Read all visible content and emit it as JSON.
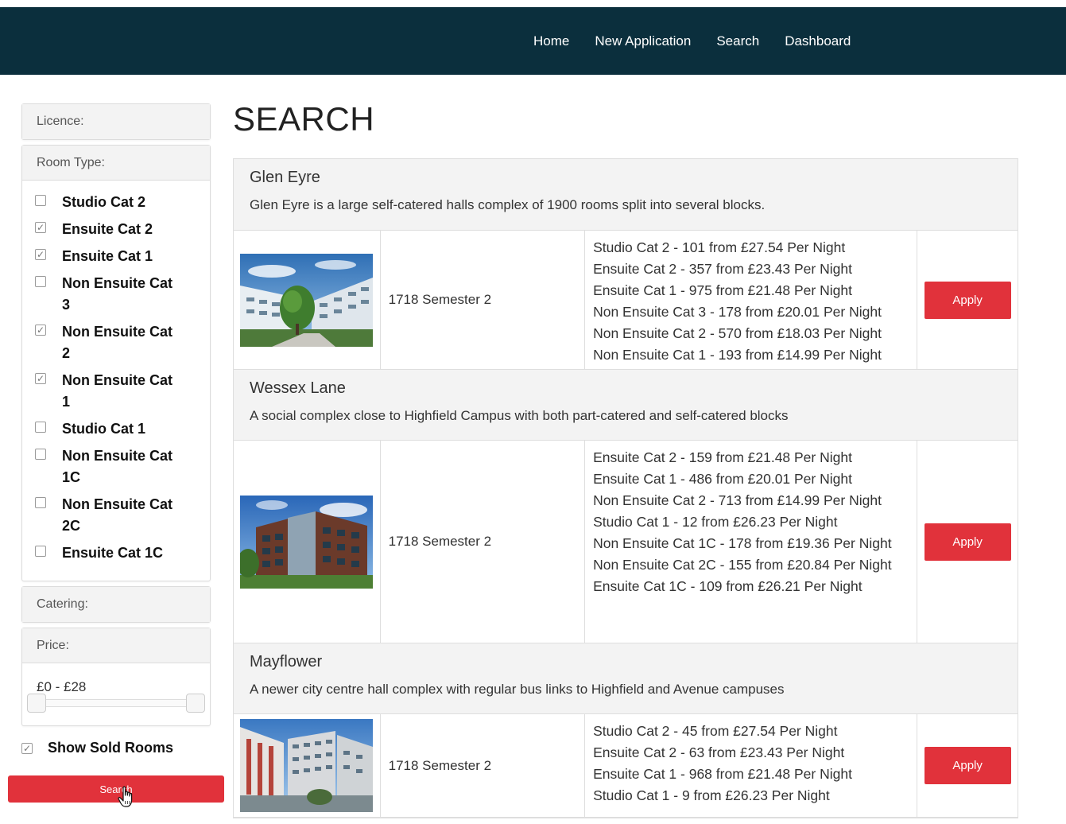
{
  "nav": {
    "items": [
      "Home",
      "New Application",
      "Search",
      "Dashboard"
    ]
  },
  "sidebar": {
    "licence_label": "Licence:",
    "room_type_label": "Room Type:",
    "room_types": [
      {
        "label": "Studio Cat 2",
        "checked": false
      },
      {
        "label": "Ensuite Cat 2",
        "checked": true
      },
      {
        "label": "Ensuite Cat 1",
        "checked": true
      },
      {
        "label": "Non Ensuite Cat 3",
        "checked": false
      },
      {
        "label": "Non Ensuite Cat 2",
        "checked": true
      },
      {
        "label": "Non Ensuite Cat 1",
        "checked": true
      },
      {
        "label": "Studio Cat 1",
        "checked": false
      },
      {
        "label": "Non Ensuite Cat 1C",
        "checked": false
      },
      {
        "label": "Non Ensuite Cat 2C",
        "checked": false
      },
      {
        "label": "Ensuite Cat 1C",
        "checked": false
      }
    ],
    "catering_label": "Catering:",
    "price_label": "Price:",
    "price_range": "£0 - £28",
    "show_sold_label": "Show Sold Rooms",
    "show_sold_checked": true,
    "search_button": "Search"
  },
  "main": {
    "title": "SEARCH",
    "halls": [
      {
        "name": "Glen Eyre",
        "description": "Glen Eyre is a large self-catered halls complex of 1900 rooms split into several blocks.",
        "semester": "1718 Semester 2",
        "rooms": [
          "Studio Cat 2 - 101 from £27.54 Per Night",
          "Ensuite Cat 2 - 357 from £23.43 Per Night",
          "Ensuite Cat 1 - 975 from £21.48 Per Night",
          "Non Ensuite Cat 3 - 178 from £20.01 Per Night",
          "Non Ensuite Cat 2 - 570 from £18.03 Per Night",
          "Non Ensuite Cat 1 - 193 from £14.99 Per Night"
        ],
        "apply_label": "Apply"
      },
      {
        "name": "Wessex Lane",
        "description": " A social complex close to Highfield Campus with both part-catered and self-catered blocks",
        "semester": "1718 Semester 2",
        "rooms": [
          "Ensuite Cat 2 - 159 from £21.48 Per Night",
          "Ensuite Cat 1 - 486 from £20.01 Per Night",
          "Non Ensuite Cat 2 - 713 from £14.99 Per Night",
          "Studio Cat 1 - 12 from £26.23 Per Night",
          "Non Ensuite Cat 1C - 178 from £19.36 Per Night",
          "Non Ensuite Cat 2C - 155 from £20.84 Per Night",
          "Ensuite Cat 1C - 109 from £26.21 Per Night"
        ],
        "apply_label": "Apply"
      },
      {
        "name": "Mayflower",
        "description": "A newer city centre hall complex with regular bus links to Highfield and Avenue campuses",
        "semester": "1718 Semester 2",
        "rooms": [
          "Studio Cat 2 - 45 from £27.54 Per Night",
          "Ensuite Cat 2 - 63 from £23.43 Per Night",
          "Ensuite Cat 1 - 968 from £21.48 Per Night",
          "Studio Cat 1 - 9 from £26.23 Per Night"
        ],
        "apply_label": "Apply"
      }
    ]
  },
  "colors": {
    "navbar": "#0b2f3d",
    "accent_red": "#e1323b",
    "panel_header": "#f3f3f3"
  }
}
